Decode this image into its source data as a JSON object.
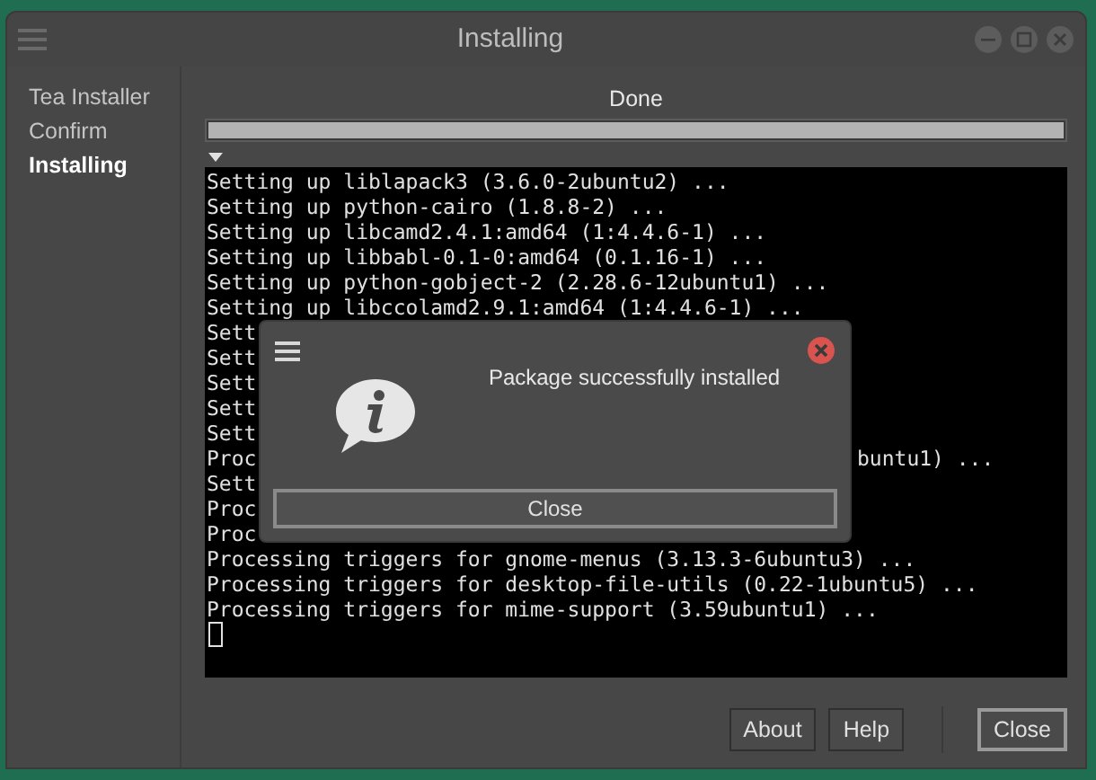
{
  "window": {
    "title": "Installing"
  },
  "sidebar": {
    "items": [
      {
        "label": "Tea Installer",
        "selected": false
      },
      {
        "label": "Confirm",
        "selected": false
      },
      {
        "label": "Installing",
        "selected": true
      }
    ]
  },
  "status": "Done",
  "progress": {
    "level": 1
  },
  "terminal": {
    "lines": [
      {
        "text": "Setting up liblapack3 (3.6.0-2ubuntu2) ..."
      },
      {
        "text": "Setting up python-cairo (1.8.8-2) ..."
      },
      {
        "text": "Setting up libcamd2.4.1:amd64 (1:4.4.6-1) ..."
      },
      {
        "text": "Setting up libbabl-0.1-0:amd64 (0.1.16-1) ..."
      },
      {
        "text": "Setting up python-gobject-2 (2.28.6-12ubuntu1) ..."
      },
      {
        "text": "Setting up libccolamd2.9.1:amd64 (1:4.4.6-1) ..."
      },
      {
        "text": "Sett"
      },
      {
        "text": "Sett"
      },
      {
        "text": "Sett"
      },
      {
        "text": "Sett"
      },
      {
        "text": "Sett"
      },
      {
        "text": "Proc",
        "tail": "buntu1) ..."
      },
      {
        "text": "Sett"
      },
      {
        "text": "Proc"
      },
      {
        "text": "Proc"
      },
      {
        "text": "Processing triggers for gnome-menus (3.13.3-6ubuntu3) ..."
      },
      {
        "text": "Processing triggers for desktop-file-utils (0.22-1ubuntu5) ..."
      },
      {
        "text": "Processing triggers for mime-support (3.59ubuntu1) ..."
      }
    ]
  },
  "dialog": {
    "message": "Package successfully installed",
    "button": "Close"
  },
  "buttons": [
    {
      "label": "About",
      "kind": "plain"
    },
    {
      "label": "Help",
      "kind": "plain"
    },
    {
      "label": "Close",
      "kind": "default"
    }
  ]
}
